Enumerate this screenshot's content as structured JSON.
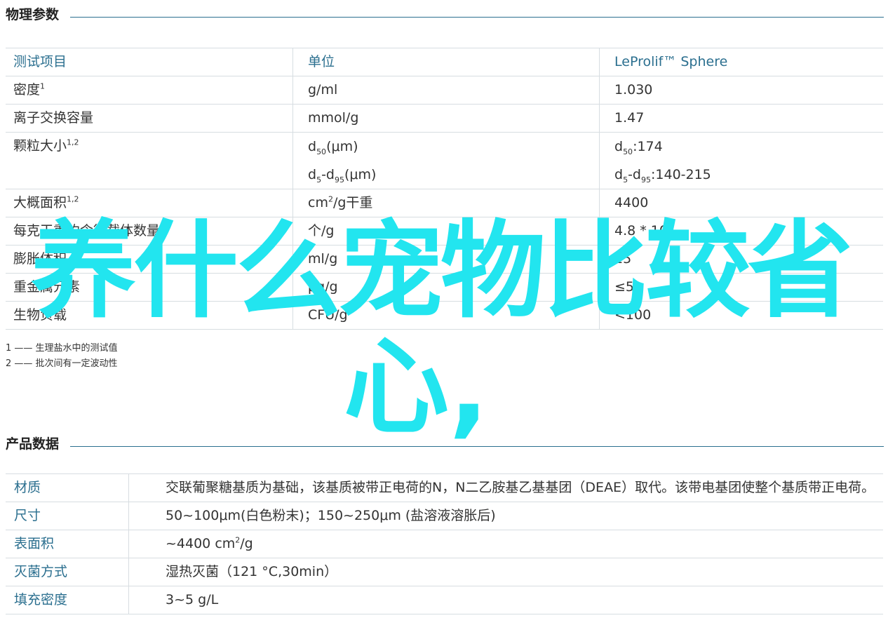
{
  "sections": {
    "physical_title": "物理参数",
    "product_title": "产品数据"
  },
  "physical_table": {
    "headers": [
      "测试项目",
      "单位",
      "LeProlif™ Sphere"
    ],
    "rows": [
      {
        "item": "密度",
        "sup": "1",
        "unit": "g/ml",
        "value": "1.030"
      },
      {
        "item": "离子交换容量",
        "sup": "",
        "unit": "mmol/g",
        "value": "1.47"
      },
      {
        "item": "颗粒大小",
        "sup": "1,2",
        "unit_lines": [
          {
            "base": "d",
            "sub1": "50",
            "mid": "",
            "sub2": "",
            "tail": "(μm)"
          },
          {
            "base": "d",
            "sub1": "5",
            "mid": "-d",
            "sub2": "95",
            "tail": "(μm)"
          }
        ],
        "value_lines": [
          {
            "base": "d",
            "sub1": "50",
            "mid": "",
            "sub2": "",
            "tail": ":174"
          },
          {
            "base": "d",
            "sub1": "5",
            "mid": "-d",
            "sub2": "95",
            "tail": ":140-215"
          }
        ]
      },
      {
        "item": "大概面积",
        "sup": "1,2",
        "unit_pre": "cm",
        "unit_sup": "2",
        "unit_post": "/g干重",
        "value": "4400"
      },
      {
        "item": "每克干重约含微载体数量",
        "sup": "",
        "unit": "个/g",
        "value_pre": "4.8 * 10",
        "value_sup": "6"
      },
      {
        "item": "膨胀体积",
        "sup": "",
        "unit": "ml/g",
        "value": "15"
      },
      {
        "item": "重金属元素",
        "sup": "",
        "unit": "μg/g",
        "value": "≤5"
      },
      {
        "item": "生物负载",
        "sup": "",
        "unit": "CFU/g",
        "value": "<100"
      }
    ]
  },
  "footnotes": [
    "1 —— 生理盐水中的测试值",
    "2 —— 批次间有一定波动性"
  ],
  "product_table": [
    {
      "key": "材质",
      "value": "交联葡聚糖基质为基础，该基质被带正电荷的N，N二乙胺基乙基基团（DEAE）取代。该带电基团使整个基质带正电荷。"
    },
    {
      "key": "尺寸",
      "value": "50~100μm(白色粉末)；150~250μm (盐溶液溶胀后)"
    },
    {
      "key": "表面积",
      "value_pre": "~4400 cm",
      "value_sup": "2",
      "value_post": "/g"
    },
    {
      "key": "灭菌方式",
      "value": "湿热灭菌（121 °C,30min）"
    },
    {
      "key": "填充密度",
      "value": "3~5 g/L"
    }
  ],
  "watermark": {
    "line1": "养什么宠物比较省",
    "line2": "心,",
    "color": "#22e5ef"
  },
  "colors": {
    "accent": "#2b6f8f",
    "border": "#d7dde1"
  }
}
